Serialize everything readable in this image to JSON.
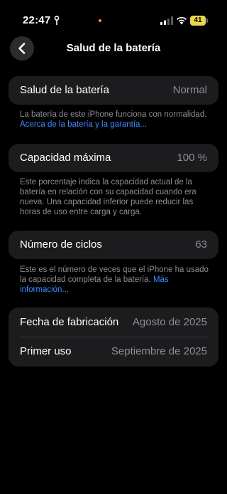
{
  "status_bar": {
    "time": "22:47",
    "battery_level": "41",
    "icons": [
      "location-icon",
      "signal-icon",
      "wifi-icon",
      "battery-icon"
    ],
    "colors": {
      "battery": "#e9d44b",
      "recording_dot": "#ff8a2a"
    }
  },
  "nav": {
    "title": "Salud de la batería",
    "back_icon": "chevron-left-icon"
  },
  "health": {
    "label": "Salud de la batería",
    "value": "Normal",
    "footer_text": "La batería de este iPhone funciona con normalidad. ",
    "footer_link": "Acerca de la batería y la garantía..."
  },
  "capacity": {
    "label": "Capacidad máxima",
    "value": "100 %",
    "footer_text": "Este porcentaje indica la capacidad actual de la batería en relación con su capacidad cuando era nueva. Una capacidad inferior puede reducir las horas de uso entre carga y carga."
  },
  "cycles": {
    "label": "Número de ciclos",
    "value": "63",
    "footer_text": "Este es el número de veces que el iPhone ha usado la capacidad completa de la batería. ",
    "footer_link": "Más información..."
  },
  "dates": {
    "manufacture_label": "Fecha de fabricación",
    "manufacture_value": "Agosto de 2025",
    "first_use_label": "Primer uso",
    "first_use_value": "Septiembre de 2025"
  },
  "colors": {
    "background": "#000000",
    "card": "#1c1c1e",
    "secondary_text": "#8e8e93",
    "link": "#3a8cff"
  }
}
